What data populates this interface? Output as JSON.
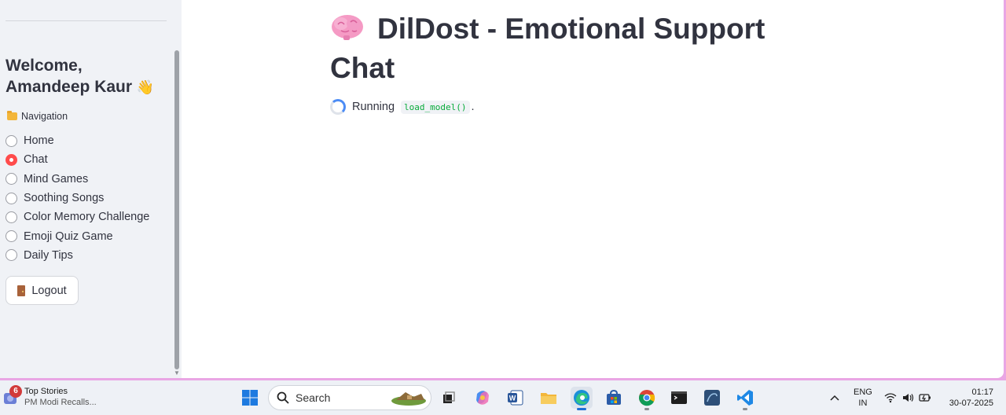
{
  "sidebar": {
    "welcome": "Welcome, Amandeep Kaur",
    "welcome_emoji": "👋",
    "nav_heading": "Navigation",
    "nav_items": [
      {
        "label": "Home",
        "selected": false
      },
      {
        "label": "Chat",
        "selected": true
      },
      {
        "label": "Mind Games",
        "selected": false
      },
      {
        "label": "Soothing Songs",
        "selected": false
      },
      {
        "label": "Color Memory Challenge",
        "selected": false
      },
      {
        "label": "Emoji Quiz Game",
        "selected": false
      },
      {
        "label": "Daily Tips",
        "selected": false
      }
    ],
    "logout_label": "Logout"
  },
  "main": {
    "title": "DilDost - Emotional Support Chat",
    "status_prefix": "Running",
    "status_code": "load_model()",
    "status_suffix": "."
  },
  "taskbar": {
    "news_badge": "6",
    "news_title": "Top Stories",
    "news_sub": "PM Modi Recalls...",
    "search_label": "Search",
    "lang": "ENG",
    "region": "IN",
    "time": "01:17",
    "date": "30-07-2025"
  },
  "colors": {
    "accent": "#ff4b4b",
    "sidebar_bg": "#f0f2f6",
    "text": "#31333f",
    "frame": "#e9a6e4"
  }
}
